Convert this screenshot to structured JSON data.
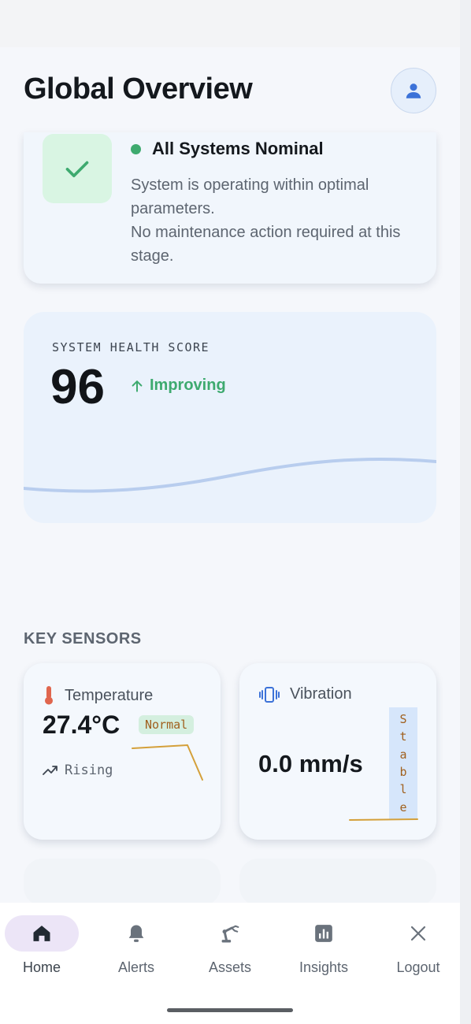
{
  "header": {
    "title": "Global Overview",
    "avatar_icon": "person-icon"
  },
  "status_card": {
    "icon": "check-icon",
    "title": "All Systems Nominal",
    "description_line1": "System is operating within optimal parameters.",
    "description_line2": "No maintenance action required at this stage.",
    "status_color": "#3eaa6f"
  },
  "health": {
    "label": "SYSTEM HEALTH SCORE",
    "score": "96",
    "trend": "Improving",
    "trend_color": "#3eaa6f"
  },
  "sensors_section": {
    "title": "KEY SENSORS"
  },
  "sensors": {
    "temperature": {
      "name": "Temperature",
      "icon": "thermometer-icon",
      "value": "27.4°C",
      "badge": "Normal",
      "trend": "Rising",
      "trend_icon": "trending-up-icon"
    },
    "vibration": {
      "name": "Vibration",
      "icon": "vibration-icon",
      "value": "0.0 mm/s",
      "badge_letters": [
        "S",
        "t",
        "a",
        "b",
        "l",
        "e"
      ]
    }
  },
  "nav": {
    "items": [
      {
        "label": "Home",
        "icon": "home-icon",
        "active": true
      },
      {
        "label": "Alerts",
        "icon": "bell-icon",
        "active": false
      },
      {
        "label": "Assets",
        "icon": "robot-arm-icon",
        "active": false
      },
      {
        "label": "Insights",
        "icon": "bar-chart-icon",
        "active": false
      },
      {
        "label": "Logout",
        "icon": "close-icon",
        "active": false
      }
    ]
  },
  "colors": {
    "accent": "#3c72d8",
    "success": "#3eaa6f",
    "warning_text": "#a0601e",
    "nav_active_bg": "#ece5f7"
  }
}
